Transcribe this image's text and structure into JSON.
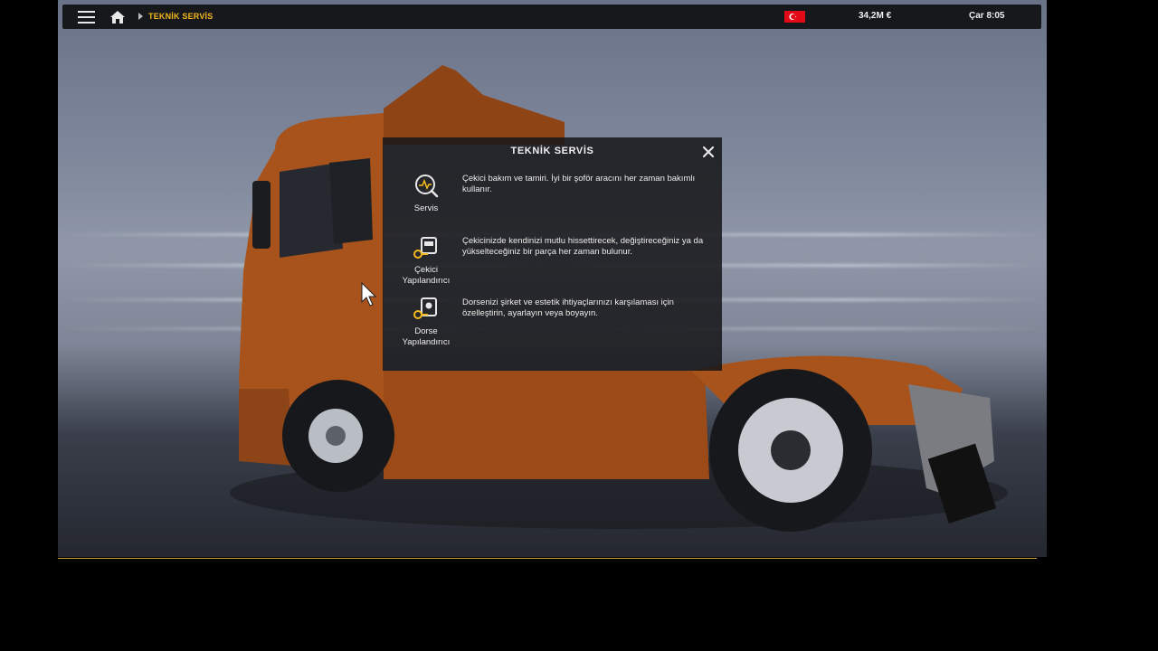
{
  "topbar": {
    "breadcrumb": "TEKNİK SERVİS",
    "money": "34,2M €",
    "clock": "Çar 8:05"
  },
  "dialog": {
    "title": "TEKNİK SERVİS",
    "options": [
      {
        "label": "Servis",
        "icon": "wrench-gauge-icon",
        "description": "Çekici bakım ve tamiri. İyi bir şoför aracını her zaman bakımlı kullanır."
      },
      {
        "label": "Çekici Yapılandırıcı",
        "icon": "truck-config-icon",
        "description": "Çekicinizde kendinizi mutlu hissettirecek, değiştireceğiniz ya da yükselteceğiniz bir parça her zaman bulunur."
      },
      {
        "label": "Dorse Yapılandırıcı",
        "icon": "trailer-config-icon",
        "description": "Dorsenizi şirket ve estetik ihtiyaçlarınızı karşılaması için özelleştirin, ayarlayın veya boyayın."
      }
    ]
  },
  "colors": {
    "accent": "#f2b81d",
    "truck": "#a9541c",
    "panel": "#161618"
  }
}
